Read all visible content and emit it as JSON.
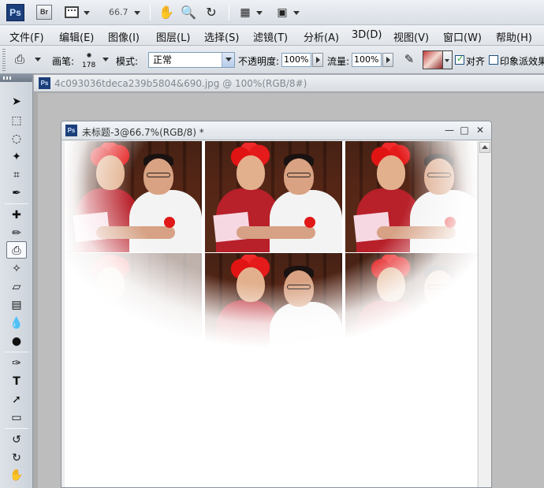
{
  "appbar": {
    "logo": "Ps",
    "bridge": "Br",
    "zoom": "66.7"
  },
  "menu": {
    "items": [
      "文件(F)",
      "编辑(E)",
      "图像(I)",
      "图层(L)",
      "选择(S)",
      "滤镜(T)",
      "分析(A)",
      "3D(D)",
      "视图(V)",
      "窗口(W)",
      "帮助(H)"
    ]
  },
  "options": {
    "brush_label": "画笔:",
    "brush_size": "178",
    "mode_label": "模式:",
    "mode_value": "正常",
    "opacity_label": "不透明度:",
    "opacity_value": "100%",
    "flow_label": "流量:",
    "flow_value": "100%",
    "align_label": "对齐",
    "align_checked": true,
    "impressionist_label": "印象派效果",
    "impressionist_checked": false
  },
  "doc_tab": {
    "icon": "Ps",
    "title": "4c093036tdeca239b5804&690.jpg @ 100%(RGB/8#)"
  },
  "float_window": {
    "icon": "Ps",
    "title": "未标题-3@66.7%(RGB/8) *",
    "minimize": "—",
    "maximize": "□",
    "close": "✕"
  }
}
